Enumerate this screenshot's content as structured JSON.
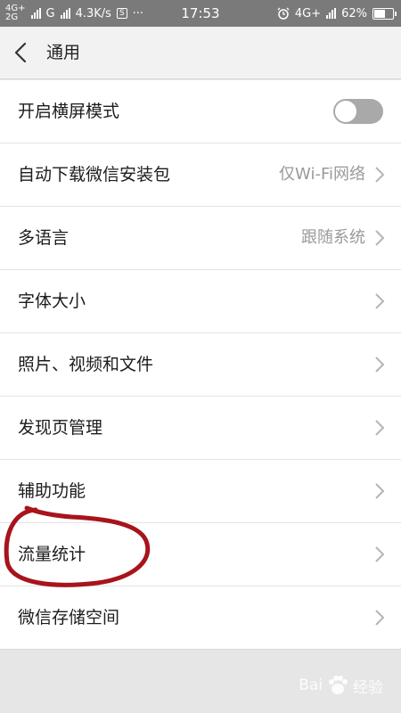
{
  "status_bar": {
    "net_top": "4G+",
    "net_bottom": "2G",
    "net_g": "G",
    "speed": "4.3K/s",
    "s_badge": "S",
    "dots": "···",
    "time": "17:53",
    "net_right": "4G+",
    "battery": "62%",
    "battery_level": 0.62
  },
  "header": {
    "title": "通用"
  },
  "settings": {
    "landscape": {
      "label": "开启横屏模式"
    },
    "auto_download": {
      "label": "自动下载微信安装包",
      "value": "仅Wi-Fi网络"
    },
    "language": {
      "label": "多语言",
      "value": "跟随系统"
    },
    "font_size": {
      "label": "字体大小"
    },
    "media": {
      "label": "照片、视频和文件"
    },
    "discover": {
      "label": "发现页管理"
    },
    "accessibility": {
      "label": "辅助功能"
    },
    "traffic": {
      "label": "流量统计"
    },
    "storage": {
      "label": "微信存储空间"
    }
  },
  "watermark": {
    "text": "Bai",
    "text2": "经验"
  },
  "colors": {
    "annotation": "#a8141c",
    "toggle_off": "#a9a9a9"
  }
}
